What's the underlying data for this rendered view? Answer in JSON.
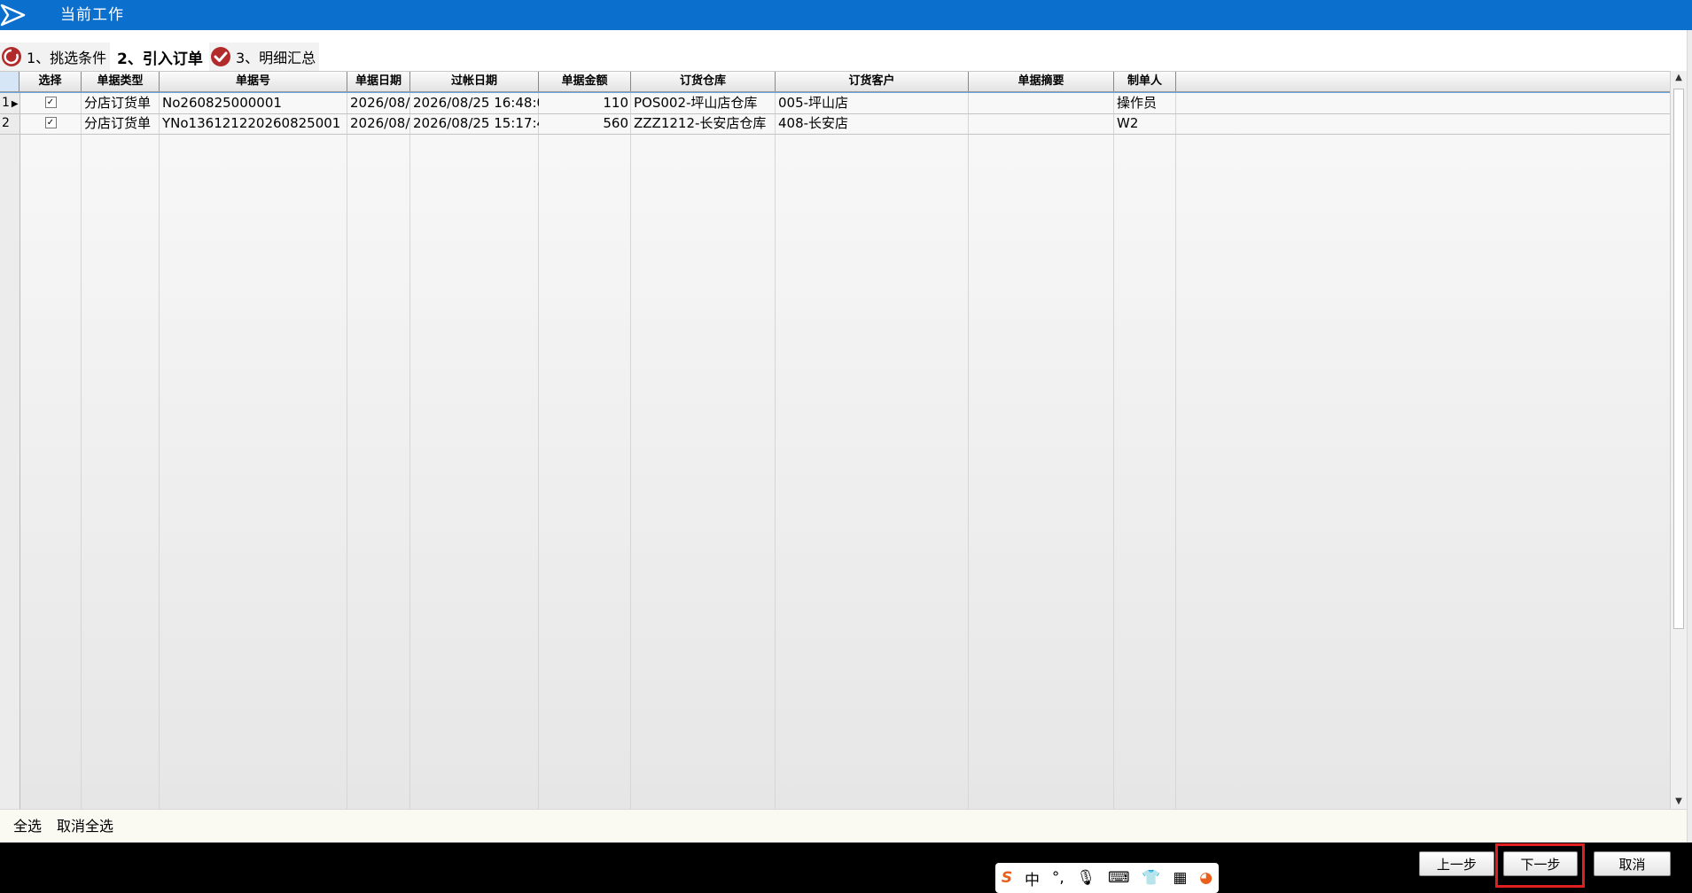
{
  "window": {
    "title": "当前工作"
  },
  "steps": [
    {
      "label": "1、挑选条件",
      "state": "inactive"
    },
    {
      "label": "2、引入订单",
      "state": "active"
    },
    {
      "label": "3、明细汇总",
      "state": "inactive"
    }
  ],
  "table": {
    "columns": [
      "选择",
      "单据类型",
      "单据号",
      "单据日期",
      "过帐日期",
      "单据金额",
      "订货仓库",
      "订货客户",
      "单据摘要",
      "制单人"
    ],
    "rows": [
      {
        "index": "1",
        "checked": true,
        "type": "分店订货单",
        "no": "No260825000001",
        "date": "2026/08/",
        "post_date": "2026/08/25 16:48:0",
        "amount": "110",
        "warehouse": "POS002-坪山店仓库",
        "customer": "005-坪山店",
        "summary": "",
        "maker": "操作员"
      },
      {
        "index": "2",
        "checked": true,
        "type": "分店订货单",
        "no": "YNo136121220260825001",
        "date": "2026/08/",
        "post_date": "2026/08/25 15:17:4",
        "amount": "560",
        "warehouse": "ZZZ1212-长安店仓库",
        "customer": "408-长安店",
        "summary": "",
        "maker": "W2"
      }
    ]
  },
  "selection": {
    "select_all": "全选",
    "deselect_all": "取消全选"
  },
  "buttons": {
    "prev": "上一步",
    "next": "下一步",
    "cancel": "取消"
  },
  "ime": {
    "mode": "中"
  },
  "colors": {
    "titlebar": "#0a6fcd",
    "step_icon": "#b22a2a",
    "highlight": "#e02020"
  }
}
